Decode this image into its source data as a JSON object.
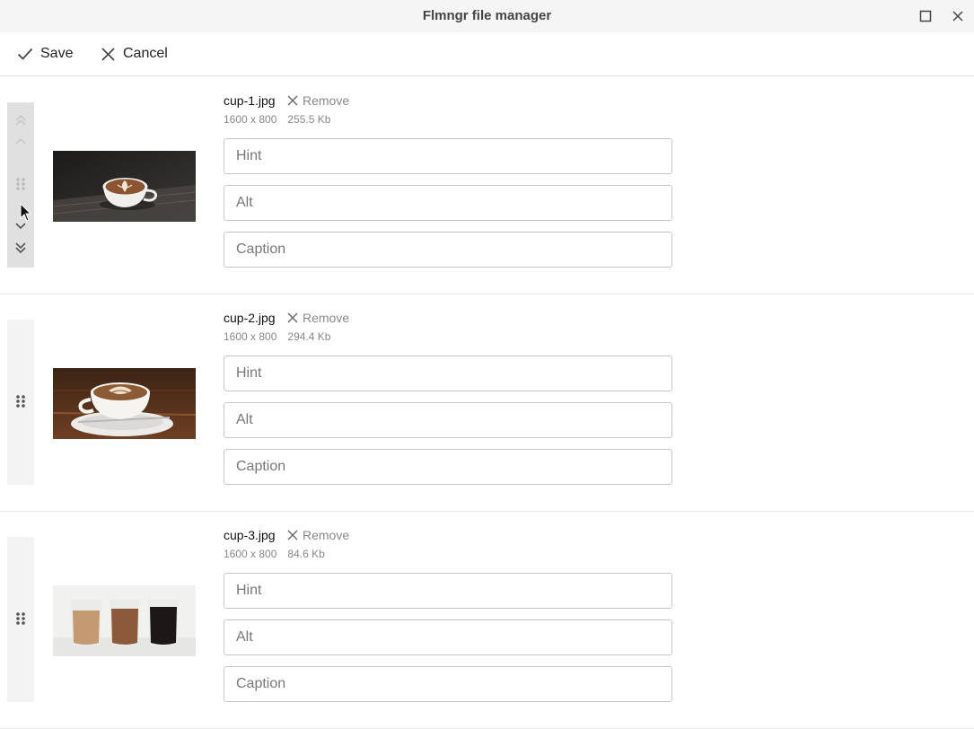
{
  "window": {
    "title": "Flmngr file manager"
  },
  "toolbar": {
    "save_label": "Save",
    "cancel_label": "Cancel"
  },
  "items": [
    {
      "name": "cup-1.jpg",
      "dimensions": "1600 x 800",
      "size": "255.5 Kb",
      "remove_label": "Remove",
      "hint_placeholder": "Hint",
      "alt_placeholder": "Alt",
      "caption_placeholder": "Caption"
    },
    {
      "name": "cup-2.jpg",
      "dimensions": "1600 x 800",
      "size": "294.4 Kb",
      "remove_label": "Remove",
      "hint_placeholder": "Hint",
      "alt_placeholder": "Alt",
      "caption_placeholder": "Caption"
    },
    {
      "name": "cup-3.jpg",
      "dimensions": "1600 x 800",
      "size": "84.6 Kb",
      "remove_label": "Remove",
      "hint_placeholder": "Hint",
      "alt_placeholder": "Alt",
      "caption_placeholder": "Caption"
    }
  ],
  "icons": [
    "maximize-icon",
    "close-icon",
    "check-icon",
    "x-icon",
    "drag-handle-icon",
    "chevron-up-double-icon",
    "chevron-up-icon",
    "chevron-down-icon",
    "chevron-down-double-icon"
  ]
}
